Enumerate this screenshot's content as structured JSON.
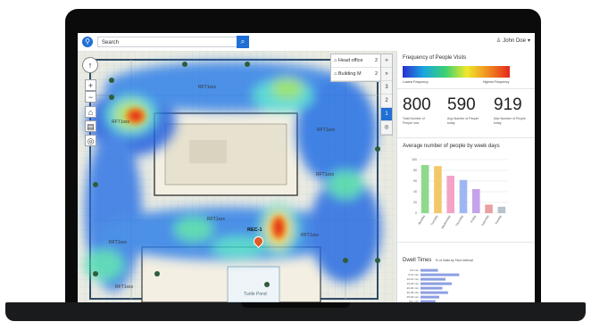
{
  "topbar": {
    "search_placeholder": "Search",
    "user_name": "John Doe",
    "caret": "▾",
    "user_icon": "user-icon",
    "search_icon": "search-icon"
  },
  "map": {
    "floors": [
      {
        "label": "Head office",
        "num": "2"
      },
      {
        "label": "Building M",
        "num": "2"
      }
    ],
    "levels": [
      "3",
      "2",
      "1"
    ],
    "active_level": "1",
    "room_labels": [
      {
        "text": "RFT1xxx"
      },
      {
        "text": "RFT1xxx"
      },
      {
        "text": "RFT1xxx"
      },
      {
        "text": "RFT1xxx"
      },
      {
        "text": "RFT1xxx"
      },
      {
        "text": "RFT1xxx"
      },
      {
        "text": "RFT1xxx"
      },
      {
        "text": "RFT1xxx"
      }
    ],
    "rec_label": "REC-1",
    "courtyard_label": "Turtle Pond",
    "controls": {
      "zoom_in": "+",
      "zoom_out": "−"
    }
  },
  "panel": {
    "frequency_title": "Frequency of People Visits",
    "legend_low": "Lowest Frequency",
    "legend_high": "Highest Frequency",
    "stats": [
      {
        "value": "800",
        "label": "Total Number of People now"
      },
      {
        "value": "590",
        "label": "Avg Number of People today"
      },
      {
        "value": "919",
        "label": "Max Number of People today"
      }
    ],
    "weekday_title": "Average number of people by week days",
    "dwell_title": "Dwell Times",
    "dwell_subtitle": "% of Visits by Time Interval"
  },
  "chart_data": [
    {
      "type": "bar",
      "title": "Average number of people by week days",
      "categories": [
        "Monday",
        "Tuesday",
        "Wednesday",
        "Thursday",
        "Friday",
        "Saturday",
        "Sunday"
      ],
      "values": [
        90,
        88,
        70,
        62,
        45,
        16,
        12
      ],
      "colors": [
        "#8fd98c",
        "#f3c86a",
        "#f2a3c7",
        "#9db7f2",
        "#c5a3ea",
        "#e8a0a0",
        "#b8c2cc"
      ],
      "ylim": [
        0,
        100
      ],
      "yticks": [
        "100",
        "80",
        "60",
        "40",
        "20",
        "0"
      ],
      "grid": true
    },
    {
      "type": "bar",
      "orientation": "horizontal",
      "title": "Dwell Times",
      "subtitle": "% of Visits by Time Interval",
      "categories": [
        "0-5 min",
        "5-10 min",
        "10-15 min",
        "15-20 min",
        "20-30 min",
        "30-45 min",
        "45-60 min",
        "60+ min"
      ],
      "values": [
        28,
        62,
        40,
        50,
        35,
        44,
        30,
        24
      ],
      "xlim": [
        0,
        100
      ]
    }
  ]
}
